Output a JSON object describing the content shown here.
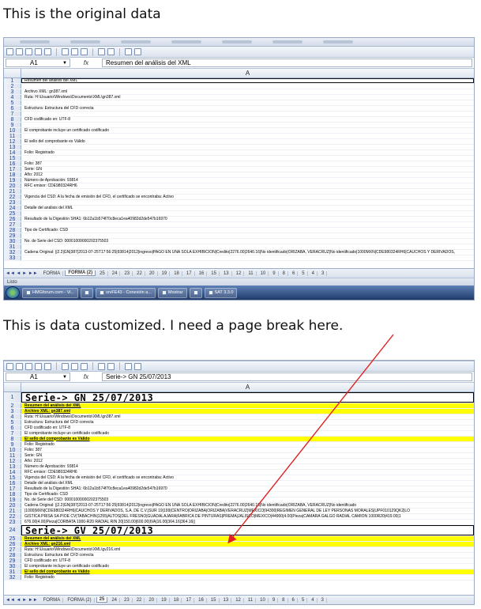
{
  "captions": {
    "top": "This is the original data",
    "bottom": "This is data customized. I need a page break here."
  },
  "colors": {
    "highlight": "#ffff00",
    "arrow": "#e02020",
    "taskbar": "#1e3a6b"
  },
  "top_sheet": {
    "cell_ref": "A1",
    "formula": "Resumen del análisis del XML",
    "column": "A",
    "rows": [
      {
        "n": "1",
        "t": "Resumen del análisis del XML"
      },
      {
        "n": "2",
        "t": ""
      },
      {
        "n": "3",
        "t": "Archivo XML: gn387.xml"
      },
      {
        "n": "4",
        "t": "Ruta: H:\\Usuario\\Windows\\Documents\\XML\\gn387.xml"
      },
      {
        "n": "5",
        "t": ""
      },
      {
        "n": "6",
        "t": "Estructura: Estructura del CFD correcta"
      },
      {
        "n": "7",
        "t": ""
      },
      {
        "n": "8",
        "t": "CFD codificado en: UTF-8"
      },
      {
        "n": "9",
        "t": ""
      },
      {
        "n": "10",
        "t": "El comprobante incluye un certificado codificado"
      },
      {
        "n": "11",
        "t": ""
      },
      {
        "n": "12",
        "t": "El sello del comprobante es Válido"
      },
      {
        "n": "13",
        "t": ""
      },
      {
        "n": "14",
        "t": "Folio: Registrado"
      },
      {
        "n": "15",
        "t": ""
      },
      {
        "n": "16",
        "t": "Folio: 387"
      },
      {
        "n": "17",
        "t": "Serie: GN"
      },
      {
        "n": "18",
        "t": "Año: 2012"
      },
      {
        "n": "19",
        "t": "Número de Aprobación: 93814"
      },
      {
        "n": "20",
        "t": "RFC emisor: CDE980324RH6"
      },
      {
        "n": "21",
        "t": ""
      },
      {
        "n": "22",
        "t": "Vigencia del CSD: A la fecha de emisión del CFD, el certificado se encontraba: Activo"
      },
      {
        "n": "23",
        "t": ""
      },
      {
        "n": "24",
        "t": "Detalle del análisis del XML"
      },
      {
        "n": "25",
        "t": ""
      },
      {
        "n": "26",
        "t": "Resultado de la Digestión SHA1: 6b12a1b574f70c8eca1ea40982d2de547b16970"
      },
      {
        "n": "27",
        "t": ""
      },
      {
        "n": "28",
        "t": "Tipo de Certificado: CSD"
      },
      {
        "n": "29",
        "t": ""
      },
      {
        "n": "30",
        "t": "No. de Serie del CSD: 00001000000202375503"
      },
      {
        "n": "31",
        "t": ""
      },
      {
        "n": "32",
        "t": "Cadena Original: ||2.2|GN|387|2013-07-25T17:56:25|93814|2012|ingreso|PAGO EN UNA SOLA EXHIBICION|Credito|2276.00|2640.16|No identificado|ORIZABA, VERACRUZ|No identificado|1000MXN|CDE980324RH6|CAUCHOS Y DERIVADOS,"
      },
      {
        "n": "33",
        "t": ""
      }
    ],
    "tabs": [
      "FORMA",
      "FORMA (2)",
      "25",
      "24",
      "23",
      "22",
      "20",
      "19",
      "18",
      "17",
      "16",
      "15",
      "13",
      "12",
      "11",
      "10",
      "9",
      "8",
      "6",
      "5",
      "4",
      "3"
    ],
    "active_tab": 1,
    "status": "Listo",
    "taskbar": [
      "HMGforum.com - Vi...",
      "",
      "srvFE43 - Conexión a...",
      "Mostrar",
      "",
      "SAT 3.3.0"
    ]
  },
  "bottom_sheet": {
    "cell_ref": "A1",
    "formula": "Serie-> GN    25/07/2013",
    "column": "A",
    "rows": [
      {
        "n": "1",
        "t": "Serie-> GN      25/07/2013",
        "k": "serie"
      },
      {
        "n": "2",
        "t": "Resumen del análisis del XML",
        "k": "y"
      },
      {
        "n": "3",
        "t": "Archivo XML: gn387.xml",
        "k": "y"
      },
      {
        "n": "4",
        "t": "Ruta: H:\\Usuario\\Windows\\Documents\\XML\\gn387.xml"
      },
      {
        "n": "5",
        "t": "Estructura: Estructura del CFD correcta"
      },
      {
        "n": "6",
        "t": "CFD codificado en: UTF-8"
      },
      {
        "n": "7",
        "t": "El comprobante incluye un certificado codificado"
      },
      {
        "n": "8",
        "t": "El sello del comprobante es Válido",
        "k": "y"
      },
      {
        "n": "9",
        "t": "Folio: Registrado"
      },
      {
        "n": "10",
        "t": "Folio: 387"
      },
      {
        "n": "11",
        "t": "Serie: GN"
      },
      {
        "n": "12",
        "t": "Año: 2012"
      },
      {
        "n": "13",
        "t": "Número de Aprobación: 93814"
      },
      {
        "n": "14",
        "t": "RFC emisor: CDE980324RH6"
      },
      {
        "n": "15",
        "t": "Vigencia del CSD: A la fecha de emisión del CFD, el certificado se encontraba: Activo"
      },
      {
        "n": "16",
        "t": "Detalle del análisis del XML"
      },
      {
        "n": "17",
        "t": "Resultado de la Digestión SHA1: 6b12a1b574f70c8eca1ea40982d2de547b16970"
      },
      {
        "n": "18",
        "t": "Tipo de Certificado: CSD"
      },
      {
        "n": "19",
        "t": "No. de Serie del CSD: 00001000000202375503"
      },
      {
        "n": "20",
        "t": "Cadena Original: ||2.2|GN|387|2013-07-25T17:56:25|93814|2012|ingreso|PAGO EN UNA SOLA EXHIBICION|Credito|2276.00|2640.16|No identificado|ORIZABA, VERACRUZ|No identificado"
      },
      {
        "n": "21",
        "t": "|1000|MXN|CDE980324RH6|CAUCHOS Y DERIVADOS, S.A. DE C.V.|SUR 19|199|CENTRO|ORIZABA|ORIZABA|VERACRUZ|MEXICO|94300|REGIMEN GENERAL DE LEY PERSONAS MORALES|UPF010129QK2|LO"
      },
      {
        "n": "22",
        "t": "GISTICA PRISA SA PIOE CV|TABACHIN|1255|ALTOS|DEL FRESNO|GUADALAJARA|FABRICA DE PINTURAS|PREMA|JALISCO|MEXICO|44900|4.00|Pieza|CAMARA GALGO RADIAL CAMION 1000R20|419.00|1"
      },
      {
        "n": "23",
        "t": "676.00|4.00|Pieza|CORBATA 1000-R20 RADIAL RIN 20|150.00|600.00|IVA|16.00|364.16|364.16||"
      },
      {
        "n": "24",
        "t": "Serie-> GV      25/07/2013",
        "k": "serie"
      },
      {
        "n": "25",
        "t": "Resumen del análisis del XML",
        "k": "y"
      },
      {
        "n": "26",
        "t": "Archivo XML: gn216.xml",
        "k": "y"
      },
      {
        "n": "27",
        "t": "Ruta: H:\\Usuario\\Windows\\Documents\\XML\\gv216.xml"
      },
      {
        "n": "28",
        "t": "Estructura: Estructura del CFD correcta"
      },
      {
        "n": "29",
        "t": "CFD codificado en: UTF-8"
      },
      {
        "n": "30",
        "t": "El comprobante incluye un certificado codificado"
      },
      {
        "n": "31",
        "t": "El sello del comprobante es Válido",
        "k": "y"
      },
      {
        "n": "32",
        "t": "Folio: Registrado"
      }
    ],
    "tabs": [
      "FORMA",
      "FORMA (2)",
      "25",
      "24",
      "23",
      "22",
      "20",
      "19",
      "18",
      "17",
      "16",
      "15",
      "13",
      "12",
      "11",
      "10",
      "9",
      "8",
      "6",
      "5",
      "4",
      "3"
    ],
    "active_tab": 2
  }
}
